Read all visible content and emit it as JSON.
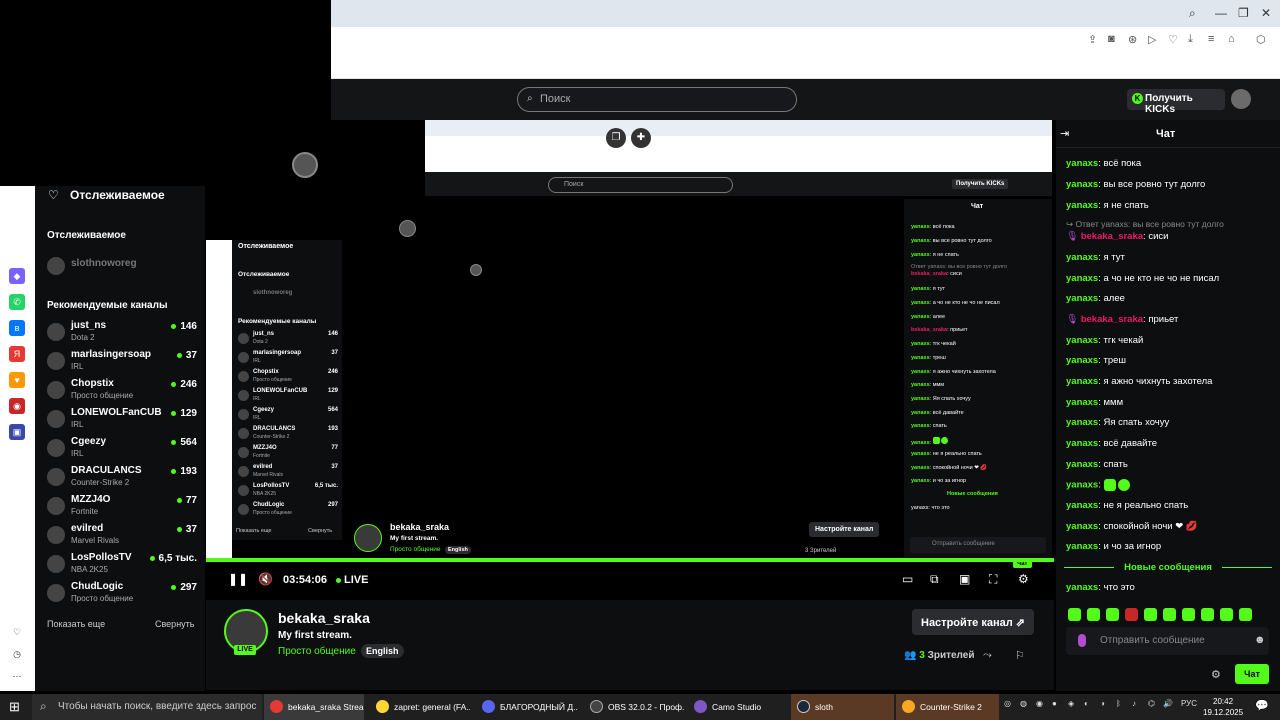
{
  "search": {
    "placeholder": "Поиск"
  },
  "header": {
    "kicks_label": "Получить KICKs",
    "kicks_mark": "K"
  },
  "sidebar": {
    "following_title": "Отслеживаемое",
    "following_header": "Отслеживаемое",
    "offline_channel": "slothnoworeg",
    "recommended_title": "Рекомендуемые каналы",
    "channels": [
      {
        "name": "just_ns",
        "game": "Dota 2",
        "viewers": "146"
      },
      {
        "name": "marlasingersoap",
        "game": "IRL",
        "viewers": "37"
      },
      {
        "name": "Chopstix",
        "game": "Просто общение",
        "viewers": "246"
      },
      {
        "name": "LONEWOLFanCUB",
        "game": "IRL",
        "viewers": "129"
      },
      {
        "name": "Cgeezy",
        "game": "IRL",
        "viewers": "564"
      },
      {
        "name": "DRACULANCS",
        "game": "Counter-Strike 2",
        "viewers": "193"
      },
      {
        "name": "MZZJ4O",
        "game": "Fortnite",
        "viewers": "77"
      },
      {
        "name": "evilred",
        "game": "Marvel Rivals",
        "viewers": "37"
      },
      {
        "name": "LosPollosTV",
        "game": "NBA 2K25",
        "viewers": "6,5 тыс."
      },
      {
        "name": "ChudLogic",
        "game": "Просто общение",
        "viewers": "297"
      }
    ],
    "show_more": "Показать еще",
    "collapse": "Свернуть"
  },
  "player": {
    "time": "03:54:06",
    "live": "LIVE",
    "progress": 1.0
  },
  "stream": {
    "streamer": "bekaka_sraka",
    "title": "My first stream.",
    "category": "Просто общение",
    "language": "English",
    "setup_label": "Настройте канал",
    "viewers_count": "3",
    "viewers_label": "Зрителей",
    "live_badge": "LIVE"
  },
  "chat": {
    "title": "Чат",
    "messages": [
      {
        "user": "yanaxs",
        "text": "всё пока"
      },
      {
        "user": "yanaxs",
        "text": "вы все ровно тут долго"
      },
      {
        "user": "yanaxs",
        "text": "я не спать"
      },
      {
        "reply": "Ответ yanaxs: вы все ровно тут долго",
        "user": "bekaka_sraka",
        "text": "сиси"
      },
      {
        "user": "yanaxs",
        "text": "я тут"
      },
      {
        "user": "yanaxs",
        "text": "а чо не кто не чо не писал"
      },
      {
        "user": "yanaxs",
        "text": "алее"
      },
      {
        "user": "bekaka_sraka",
        "text": "приьет"
      },
      {
        "user": "yanaxs",
        "text": "тгк чекай"
      },
      {
        "user": "yanaxs",
        "text": "треш"
      },
      {
        "user": "yanaxs",
        "text": "я ажно чихнуть захотела"
      },
      {
        "user": "yanaxs",
        "text": "ммм"
      },
      {
        "user": "yanaxs",
        "text": "Яя спать хочуу"
      },
      {
        "user": "yanaxs",
        "text": "всё давайте"
      },
      {
        "user": "yanaxs",
        "text": "спать"
      },
      {
        "user": "yanaxs",
        "text": ""
      },
      {
        "user": "yanaxs",
        "text": "не я реально спать"
      },
      {
        "user": "yanaxs",
        "text": "спокойной ночи ❤ 💋"
      },
      {
        "user": "yanaxs",
        "text": "и чо за игнор"
      }
    ],
    "new_messages": "Новые сообщения",
    "last_message": {
      "user": "yanaxs",
      "text": "что это"
    },
    "input_placeholder": "Отправить сообщение",
    "send_label": "Чат"
  },
  "inner": {
    "search_placeholder": "Поиск",
    "kicks_label": "Получить KICKs",
    "chat_title": "Чат",
    "following_title": "Отслеживаемое",
    "following_header": "Отслеживаемое",
    "offline_channel": "slothnoworeg",
    "recommended_title": "Рекомендуемые каналы",
    "show_more": "Показать еще",
    "collapse": "Свернуть",
    "streamer": "bekaka_sraka",
    "title": "My first stream.",
    "category": "Просто общение",
    "language": "English",
    "setup_label": "Настройте канал",
    "viewers": "3 Зрителей",
    "new_messages": "Новые сообщения",
    "last_message": "yanaxs: что это",
    "input_placeholder": "Отправить сообщение",
    "send_label": "Чат"
  },
  "taskbar": {
    "search_placeholder": "Чтобы начать поиск, введите здесь запрос",
    "tasks": [
      {
        "label": "bekaka_sraka Strea...",
        "color": "#e53935"
      },
      {
        "label": "zapret: general (FA...",
        "color": "#fdd835"
      },
      {
        "label": "БЛАГОРОДНЫЙ Д...",
        "color": "#5865f2"
      },
      {
        "label": "OBS 32.0.2 - Проф...",
        "color": "#444444"
      },
      {
        "label": "Camo Studio",
        "color": "#7e57c2"
      },
      {
        "label": "sloth",
        "color": "#1b2838"
      },
      {
        "label": "Counter-Strike 2",
        "color": "#f9a825"
      }
    ],
    "lang": "РУС",
    "time": "20:42",
    "date": "19.12.2025"
  },
  "colors": {
    "accent": "#53fc18",
    "bg": "#0d0e10",
    "username": "#53fc18",
    "mention": "#e91e63"
  }
}
